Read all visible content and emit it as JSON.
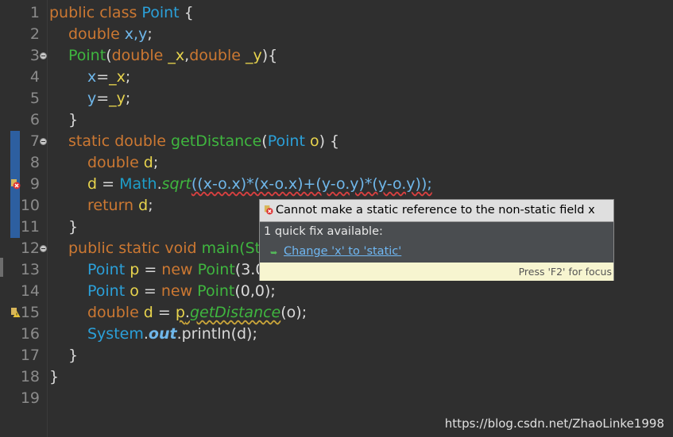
{
  "editor": {
    "line_numbers": [
      "1",
      "2",
      "3",
      "4",
      "5",
      "6",
      "7",
      "8",
      "9",
      "10",
      "11",
      "12",
      "13",
      "14",
      "15",
      "16",
      "17",
      "18",
      "19"
    ],
    "lines": {
      "l1": {
        "kw": "public class ",
        "cls": "Point",
        "rest": " {"
      },
      "l2": {
        "kw": "double ",
        "vars": "x,y",
        "rest": ";"
      },
      "l3": {
        "ctor": "Point",
        "p1": "(",
        "kw1": "double ",
        "a1": "_x",
        "comma": ",",
        "kw2": "double ",
        "a2": "_y",
        "rest": "){"
      },
      "l4": {
        "lhs": "x",
        "eq": "=",
        "rhs": "_x",
        "semi": ";"
      },
      "l5": {
        "lhs": "y",
        "eq": "=",
        "rhs": "_y",
        "semi": ";"
      },
      "l6": {
        "rest": "}"
      },
      "l7": {
        "kw": "static double ",
        "mth": "getDistance",
        "p1": "(",
        "ty": "Point",
        "sp": " ",
        "param": "o",
        "rest": ") {"
      },
      "l8": {
        "kw": "double ",
        "var": "d",
        "rest": ";"
      },
      "l9": {
        "var": "d",
        "eq": " = ",
        "cls": "Math",
        "dot": ".",
        "mth": "sqrt",
        "expr": "((x-o.x)*(x-o.x)+(y-o.y)*(y-o.y));"
      },
      "l10": {
        "kw": "return ",
        "var": "d",
        "rest": ";"
      },
      "l11": {
        "rest": "}"
      },
      "l12": {
        "kw": "public static void ",
        "mth": "main",
        "rest": "(St"
      },
      "l13": {
        "cls1": "Point",
        "var": " p",
        "eq": " = ",
        "kw": "new ",
        "cls2": "Point",
        "rest": "(3.0"
      },
      "l14": {
        "cls1": "Point",
        "var": " o",
        "eq": " = ",
        "kw": "new ",
        "cls2": "Point",
        "rest": "(0,0);"
      },
      "l15": {
        "kw": "double ",
        "var": "d",
        "eq": " = ",
        "obj": "p",
        "dot": ".",
        "mth": "getDistance",
        "rest": "(o);"
      },
      "l16": {
        "cls": "System",
        "dot": ".",
        "fld": "out",
        "rest": ".println(d);"
      },
      "l17": {
        "rest": "}"
      },
      "l18": {
        "rest": "}"
      },
      "l19": {
        "rest": ""
      }
    }
  },
  "quickfix_popup": {
    "error_message": "Cannot make a static reference to the non-static field x",
    "fix_count": "1 quick fix available:",
    "fix_item": "Change 'x' to 'static'",
    "footer": "Press 'F2' for focus"
  },
  "watermark": "https://blog.csdn.net/ZhaoLinke1998",
  "colors": {
    "background": "#2f2f2f",
    "keyword": "#cc7832",
    "type": "#1e9ec8",
    "method": "#3fb63f",
    "variable": "#e8d44d",
    "line_number": "#8b8b8b",
    "link": "#6fb7f2"
  },
  "icons": {
    "error_marker": "error-x-icon",
    "warning_marker": "warning-icon",
    "fold_marker": "collapse-icon",
    "quickfix_bullet": "fix-arrow-icon"
  }
}
